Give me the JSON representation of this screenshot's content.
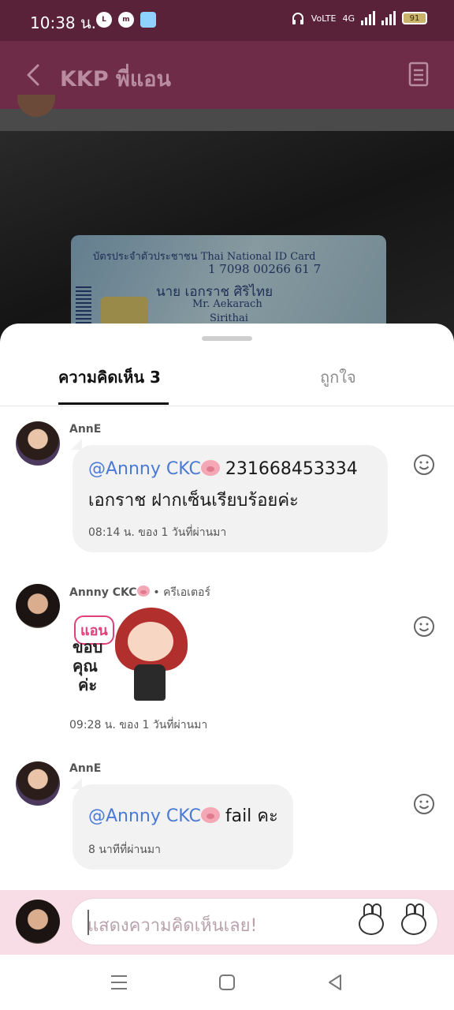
{
  "status_bar": {
    "time": "10:38 น.",
    "app_icons": [
      "line-icon",
      "messenger-icon",
      "gallery-icon"
    ],
    "network": "4G",
    "volte": "VoLTE",
    "battery": "91"
  },
  "header": {
    "title": "KKP พี่แอน"
  },
  "post_photo": {
    "card_lines": [
      "บัตรประจำตัวประชาชน   Thai National ID Card",
      "1 7098 00266 61 7",
      "นาย เอกราช ศิริไทย",
      "Mr. Aekarach",
      "Sirithai"
    ]
  },
  "tabs": {
    "comments": "ความคิดเห็น 3",
    "likes": "ถูกใจ"
  },
  "comments": [
    {
      "author": "AnnE",
      "mention": "@Annny CKC",
      "text_after_mention": " 231668453334",
      "text_line2": "เอกราช ฝากเซ็นเรียบร้อยค่ะ",
      "time": "08:14 น. ของ 1 วันที่ผ่านมา"
    },
    {
      "author": "Annny CKC",
      "role": "• ครีเอเตอร์",
      "sticker_tag": "แอน",
      "sticker_text": "ขอบ\nคุณ\n ค่ะ",
      "time": "09:28 น. ของ 1 วันที่ผ่านมา"
    },
    {
      "author": "AnnE",
      "mention": "@Annny CKC",
      "text_after_mention": " fail คะ",
      "time": "8 นาทีที่ผ่านมา"
    }
  ],
  "input": {
    "placeholder": "แสดงความคิดเห็นเลย!"
  },
  "colors": {
    "header_bg": "#6e2c48",
    "mention": "#4a7ad6",
    "input_bar_bg": "#f8dde7"
  }
}
